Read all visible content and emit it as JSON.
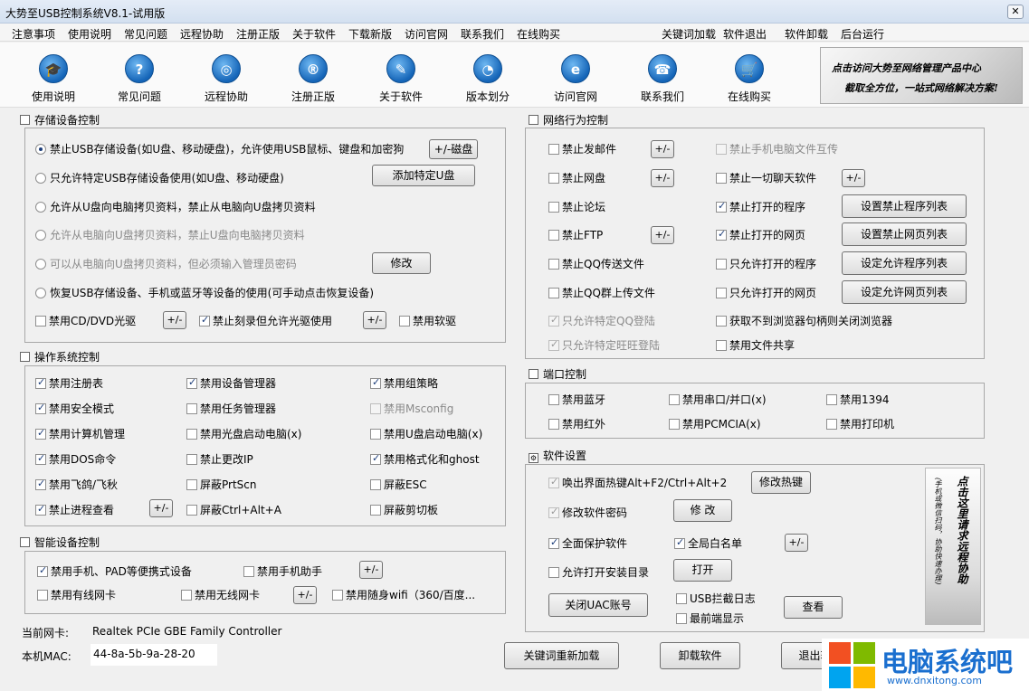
{
  "window": {
    "title": "大势至USB控制系统V8.1-试用版",
    "close": "✕"
  },
  "menu": {
    "left": [
      "注意事项",
      "使用说明",
      "常见问题",
      "远程协助",
      "注册正版",
      "关于软件",
      "下载新版",
      "访问官网",
      "联系我们",
      "在线购买"
    ],
    "right": [
      "关键词加载",
      "软件退出",
      "软件卸载",
      "后台运行"
    ]
  },
  "toolbar": [
    {
      "label": "使用说明",
      "glyph": "🎓"
    },
    {
      "label": "常见问题",
      "glyph": "?"
    },
    {
      "label": "远程协助",
      "glyph": "◎"
    },
    {
      "label": "注册正版",
      "glyph": "®"
    },
    {
      "label": "关于软件",
      "glyph": "✎"
    },
    {
      "label": "版本划分",
      "glyph": "◔"
    },
    {
      "label": "访问官网",
      "glyph": "e"
    },
    {
      "label": "联系我们",
      "glyph": "☎"
    },
    {
      "label": "在线购买",
      "glyph": "🛒"
    }
  ],
  "banner": {
    "line1": "点击访问大势至网络管理产品中心",
    "line2": "截取全方位，一站式网络解决方案!"
  },
  "storage": {
    "title": "存储设备控制",
    "radios": [
      "禁止USB存储设备(如U盘、移动硬盘)，允许使用USB鼠标、键盘和加密狗",
      "只允许特定USB存储设备使用(如U盘、移动硬盘)",
      "允许从U盘向电脑拷贝资料，禁止从电脑向U盘拷贝资料",
      "允许从电脑向U盘拷贝资料，禁止U盘向电脑拷贝资料",
      "可以从电脑向U盘拷贝资料，但必须输入管理员密码",
      "恢复USB存储设备、手机或蓝牙等设备的使用(可手动点击恢复设备)"
    ],
    "btn_disk": "+/-磁盘",
    "btn_add": "添加特定U盘",
    "btn_modify": "修改",
    "cd": "禁用CD/DVD光驱",
    "burn": "禁止刻录但允许光驱使用",
    "floppy": "禁用软驱",
    "pm": "+/-"
  },
  "os": {
    "title": "操作系统控制",
    "items": [
      "禁用注册表",
      "禁用设备管理器",
      "禁用组策略",
      "禁用安全模式",
      "禁用任务管理器",
      "禁用Msconfig",
      "禁用计算机管理",
      "禁用光盘启动电脑(x)",
      "禁用U盘启动电脑(x)",
      "禁用DOS命令",
      "禁止更改IP",
      "禁用格式化和ghost",
      "禁用飞鸽/飞秋",
      "屏蔽PrtScn",
      "屏蔽ESC",
      "禁止进程查看",
      "屏蔽Ctrl+Alt+A",
      "屏蔽剪切板"
    ],
    "pm": "+/-"
  },
  "smart": {
    "title": "智能设备控制",
    "items": [
      "禁用手机、PAD等便携式设备",
      "禁用手机助手",
      "禁用有线网卡",
      "禁用无线网卡",
      "禁用随身wifi（360/百度..."
    ],
    "pm": "+/-"
  },
  "nic": {
    "label": "当前网卡:",
    "value": "Realtek PCIe GBE Family Controller",
    "mac_label": "本机MAC:",
    "mac": "44-8a-5b-9a-28-20"
  },
  "network": {
    "title": "网络行为控制",
    "left": [
      "禁止发邮件",
      "禁止网盘",
      "禁止论坛",
      "禁止FTP",
      "禁止QQ传送文件",
      "禁止QQ群上传文件",
      "只允许特定QQ登陆",
      "只允许特定旺旺登陆"
    ],
    "right": [
      "禁止手机电脑文件互传",
      "禁止一切聊天软件",
      "禁止打开的程序",
      "禁止打开的网页",
      "只允许打开的程序",
      "只允许打开的网页",
      "获取不到浏览器句柄则关闭浏览器",
      "禁用文件共享"
    ],
    "btns": [
      "设置禁止程序列表",
      "设置禁止网页列表",
      "设定允许程序列表",
      "设定允许网页列表"
    ],
    "pm": "+/-"
  },
  "port": {
    "title": "端口控制",
    "items": [
      "禁用蓝牙",
      "禁用串口/并口(x)",
      "禁用1394",
      "禁用红外",
      "禁用PCMCIA(x)",
      "禁用打印机"
    ]
  },
  "settings": {
    "title": "软件设置",
    "hotkey": "唤出界面热键Alt+F2/Ctrl+Alt+2",
    "btn_hotkey": "修改热键",
    "pwd": "修改软件密码",
    "btn_modify": "修 改",
    "protect": "全面保护软件",
    "whitelist": "全局白名单",
    "allow_install": "允许打开安装目录",
    "btn_open": "打开",
    "btn_uac": "关闭UAC账号",
    "usb_log": "USB拦截日志",
    "topmost": "最前端显示",
    "btn_view": "查看",
    "pm": "+/-",
    "vbanner1": "点击这里请求远程协助",
    "vbanner2": "(手机或微信扫码，协助快速办理)"
  },
  "bottom": {
    "reload": "关键词重新加载",
    "uninstall": "卸载软件",
    "exit": "退出软"
  },
  "watermark": {
    "text": "电脑系统吧",
    "url": "www.dnxitong.com"
  }
}
